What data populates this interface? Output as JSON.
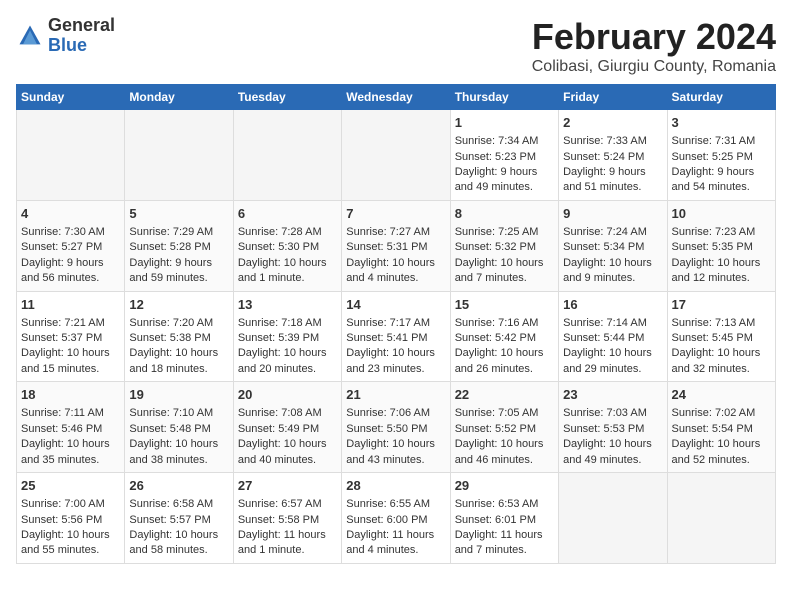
{
  "header": {
    "logo_general": "General",
    "logo_blue": "Blue",
    "month_title": "February 2024",
    "location": "Colibasi, Giurgiu County, Romania"
  },
  "days_of_week": [
    "Sunday",
    "Monday",
    "Tuesday",
    "Wednesday",
    "Thursday",
    "Friday",
    "Saturday"
  ],
  "weeks": [
    [
      {
        "day": "",
        "content": ""
      },
      {
        "day": "",
        "content": ""
      },
      {
        "day": "",
        "content": ""
      },
      {
        "day": "",
        "content": ""
      },
      {
        "day": "1",
        "content": "Sunrise: 7:34 AM\nSunset: 5:23 PM\nDaylight: 9 hours and 49 minutes."
      },
      {
        "day": "2",
        "content": "Sunrise: 7:33 AM\nSunset: 5:24 PM\nDaylight: 9 hours and 51 minutes."
      },
      {
        "day": "3",
        "content": "Sunrise: 7:31 AM\nSunset: 5:25 PM\nDaylight: 9 hours and 54 minutes."
      }
    ],
    [
      {
        "day": "4",
        "content": "Sunrise: 7:30 AM\nSunset: 5:27 PM\nDaylight: 9 hours and 56 minutes."
      },
      {
        "day": "5",
        "content": "Sunrise: 7:29 AM\nSunset: 5:28 PM\nDaylight: 9 hours and 59 minutes."
      },
      {
        "day": "6",
        "content": "Sunrise: 7:28 AM\nSunset: 5:30 PM\nDaylight: 10 hours and 1 minute."
      },
      {
        "day": "7",
        "content": "Sunrise: 7:27 AM\nSunset: 5:31 PM\nDaylight: 10 hours and 4 minutes."
      },
      {
        "day": "8",
        "content": "Sunrise: 7:25 AM\nSunset: 5:32 PM\nDaylight: 10 hours and 7 minutes."
      },
      {
        "day": "9",
        "content": "Sunrise: 7:24 AM\nSunset: 5:34 PM\nDaylight: 10 hours and 9 minutes."
      },
      {
        "day": "10",
        "content": "Sunrise: 7:23 AM\nSunset: 5:35 PM\nDaylight: 10 hours and 12 minutes."
      }
    ],
    [
      {
        "day": "11",
        "content": "Sunrise: 7:21 AM\nSunset: 5:37 PM\nDaylight: 10 hours and 15 minutes."
      },
      {
        "day": "12",
        "content": "Sunrise: 7:20 AM\nSunset: 5:38 PM\nDaylight: 10 hours and 18 minutes."
      },
      {
        "day": "13",
        "content": "Sunrise: 7:18 AM\nSunset: 5:39 PM\nDaylight: 10 hours and 20 minutes."
      },
      {
        "day": "14",
        "content": "Sunrise: 7:17 AM\nSunset: 5:41 PM\nDaylight: 10 hours and 23 minutes."
      },
      {
        "day": "15",
        "content": "Sunrise: 7:16 AM\nSunset: 5:42 PM\nDaylight: 10 hours and 26 minutes."
      },
      {
        "day": "16",
        "content": "Sunrise: 7:14 AM\nSunset: 5:44 PM\nDaylight: 10 hours and 29 minutes."
      },
      {
        "day": "17",
        "content": "Sunrise: 7:13 AM\nSunset: 5:45 PM\nDaylight: 10 hours and 32 minutes."
      }
    ],
    [
      {
        "day": "18",
        "content": "Sunrise: 7:11 AM\nSunset: 5:46 PM\nDaylight: 10 hours and 35 minutes."
      },
      {
        "day": "19",
        "content": "Sunrise: 7:10 AM\nSunset: 5:48 PM\nDaylight: 10 hours and 38 minutes."
      },
      {
        "day": "20",
        "content": "Sunrise: 7:08 AM\nSunset: 5:49 PM\nDaylight: 10 hours and 40 minutes."
      },
      {
        "day": "21",
        "content": "Sunrise: 7:06 AM\nSunset: 5:50 PM\nDaylight: 10 hours and 43 minutes."
      },
      {
        "day": "22",
        "content": "Sunrise: 7:05 AM\nSunset: 5:52 PM\nDaylight: 10 hours and 46 minutes."
      },
      {
        "day": "23",
        "content": "Sunrise: 7:03 AM\nSunset: 5:53 PM\nDaylight: 10 hours and 49 minutes."
      },
      {
        "day": "24",
        "content": "Sunrise: 7:02 AM\nSunset: 5:54 PM\nDaylight: 10 hours and 52 minutes."
      }
    ],
    [
      {
        "day": "25",
        "content": "Sunrise: 7:00 AM\nSunset: 5:56 PM\nDaylight: 10 hours and 55 minutes."
      },
      {
        "day": "26",
        "content": "Sunrise: 6:58 AM\nSunset: 5:57 PM\nDaylight: 10 hours and 58 minutes."
      },
      {
        "day": "27",
        "content": "Sunrise: 6:57 AM\nSunset: 5:58 PM\nDaylight: 11 hours and 1 minute."
      },
      {
        "day": "28",
        "content": "Sunrise: 6:55 AM\nSunset: 6:00 PM\nDaylight: 11 hours and 4 minutes."
      },
      {
        "day": "29",
        "content": "Sunrise: 6:53 AM\nSunset: 6:01 PM\nDaylight: 11 hours and 7 minutes."
      },
      {
        "day": "",
        "content": ""
      },
      {
        "day": "",
        "content": ""
      }
    ]
  ]
}
